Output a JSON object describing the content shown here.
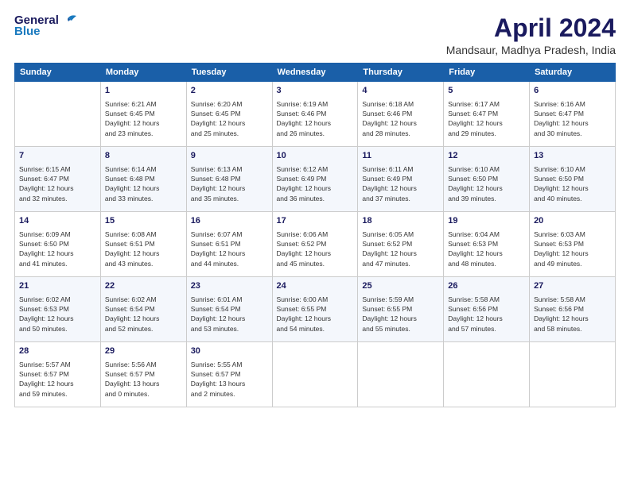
{
  "header": {
    "logo_line1": "General",
    "logo_line2": "Blue",
    "title": "April 2024",
    "subtitle": "Mandsaur, Madhya Pradesh, India"
  },
  "weekdays": [
    "Sunday",
    "Monday",
    "Tuesday",
    "Wednesday",
    "Thursday",
    "Friday",
    "Saturday"
  ],
  "weeks": [
    {
      "bg": "row-bg-1",
      "days": [
        {
          "num": "",
          "info": ""
        },
        {
          "num": "1",
          "info": "Sunrise: 6:21 AM\nSunset: 6:45 PM\nDaylight: 12 hours\nand 23 minutes."
        },
        {
          "num": "2",
          "info": "Sunrise: 6:20 AM\nSunset: 6:45 PM\nDaylight: 12 hours\nand 25 minutes."
        },
        {
          "num": "3",
          "info": "Sunrise: 6:19 AM\nSunset: 6:46 PM\nDaylight: 12 hours\nand 26 minutes."
        },
        {
          "num": "4",
          "info": "Sunrise: 6:18 AM\nSunset: 6:46 PM\nDaylight: 12 hours\nand 28 minutes."
        },
        {
          "num": "5",
          "info": "Sunrise: 6:17 AM\nSunset: 6:47 PM\nDaylight: 12 hours\nand 29 minutes."
        },
        {
          "num": "6",
          "info": "Sunrise: 6:16 AM\nSunset: 6:47 PM\nDaylight: 12 hours\nand 30 minutes."
        }
      ]
    },
    {
      "bg": "row-bg-2",
      "days": [
        {
          "num": "7",
          "info": "Sunrise: 6:15 AM\nSunset: 6:47 PM\nDaylight: 12 hours\nand 32 minutes."
        },
        {
          "num": "8",
          "info": "Sunrise: 6:14 AM\nSunset: 6:48 PM\nDaylight: 12 hours\nand 33 minutes."
        },
        {
          "num": "9",
          "info": "Sunrise: 6:13 AM\nSunset: 6:48 PM\nDaylight: 12 hours\nand 35 minutes."
        },
        {
          "num": "10",
          "info": "Sunrise: 6:12 AM\nSunset: 6:49 PM\nDaylight: 12 hours\nand 36 minutes."
        },
        {
          "num": "11",
          "info": "Sunrise: 6:11 AM\nSunset: 6:49 PM\nDaylight: 12 hours\nand 37 minutes."
        },
        {
          "num": "12",
          "info": "Sunrise: 6:10 AM\nSunset: 6:50 PM\nDaylight: 12 hours\nand 39 minutes."
        },
        {
          "num": "13",
          "info": "Sunrise: 6:10 AM\nSunset: 6:50 PM\nDaylight: 12 hours\nand 40 minutes."
        }
      ]
    },
    {
      "bg": "row-bg-1",
      "days": [
        {
          "num": "14",
          "info": "Sunrise: 6:09 AM\nSunset: 6:50 PM\nDaylight: 12 hours\nand 41 minutes."
        },
        {
          "num": "15",
          "info": "Sunrise: 6:08 AM\nSunset: 6:51 PM\nDaylight: 12 hours\nand 43 minutes."
        },
        {
          "num": "16",
          "info": "Sunrise: 6:07 AM\nSunset: 6:51 PM\nDaylight: 12 hours\nand 44 minutes."
        },
        {
          "num": "17",
          "info": "Sunrise: 6:06 AM\nSunset: 6:52 PM\nDaylight: 12 hours\nand 45 minutes."
        },
        {
          "num": "18",
          "info": "Sunrise: 6:05 AM\nSunset: 6:52 PM\nDaylight: 12 hours\nand 47 minutes."
        },
        {
          "num": "19",
          "info": "Sunrise: 6:04 AM\nSunset: 6:53 PM\nDaylight: 12 hours\nand 48 minutes."
        },
        {
          "num": "20",
          "info": "Sunrise: 6:03 AM\nSunset: 6:53 PM\nDaylight: 12 hours\nand 49 minutes."
        }
      ]
    },
    {
      "bg": "row-bg-2",
      "days": [
        {
          "num": "21",
          "info": "Sunrise: 6:02 AM\nSunset: 6:53 PM\nDaylight: 12 hours\nand 50 minutes."
        },
        {
          "num": "22",
          "info": "Sunrise: 6:02 AM\nSunset: 6:54 PM\nDaylight: 12 hours\nand 52 minutes."
        },
        {
          "num": "23",
          "info": "Sunrise: 6:01 AM\nSunset: 6:54 PM\nDaylight: 12 hours\nand 53 minutes."
        },
        {
          "num": "24",
          "info": "Sunrise: 6:00 AM\nSunset: 6:55 PM\nDaylight: 12 hours\nand 54 minutes."
        },
        {
          "num": "25",
          "info": "Sunrise: 5:59 AM\nSunset: 6:55 PM\nDaylight: 12 hours\nand 55 minutes."
        },
        {
          "num": "26",
          "info": "Sunrise: 5:58 AM\nSunset: 6:56 PM\nDaylight: 12 hours\nand 57 minutes."
        },
        {
          "num": "27",
          "info": "Sunrise: 5:58 AM\nSunset: 6:56 PM\nDaylight: 12 hours\nand 58 minutes."
        }
      ]
    },
    {
      "bg": "row-bg-1",
      "days": [
        {
          "num": "28",
          "info": "Sunrise: 5:57 AM\nSunset: 6:57 PM\nDaylight: 12 hours\nand 59 minutes."
        },
        {
          "num": "29",
          "info": "Sunrise: 5:56 AM\nSunset: 6:57 PM\nDaylight: 13 hours\nand 0 minutes."
        },
        {
          "num": "30",
          "info": "Sunrise: 5:55 AM\nSunset: 6:57 PM\nDaylight: 13 hours\nand 2 minutes."
        },
        {
          "num": "",
          "info": ""
        },
        {
          "num": "",
          "info": ""
        },
        {
          "num": "",
          "info": ""
        },
        {
          "num": "",
          "info": ""
        }
      ]
    }
  ]
}
